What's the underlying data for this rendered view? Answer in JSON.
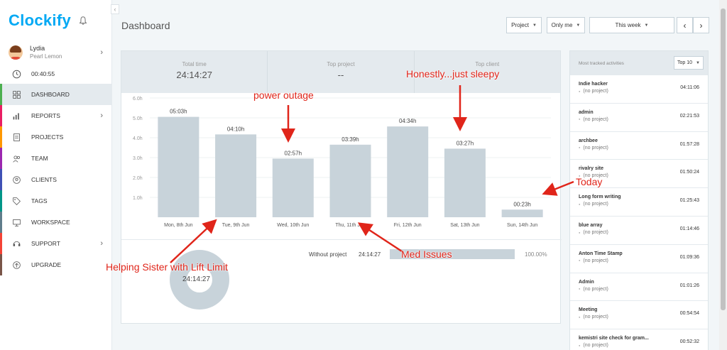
{
  "app": {
    "logo_text": "Clockify",
    "page_title": "Dashboard"
  },
  "user": {
    "name": "Lydia",
    "workspace": "Pearl Lemon"
  },
  "timer": "00:40:55",
  "nav": [
    {
      "label": "DASHBOARD",
      "icon": "dashboard-icon",
      "color": "#4caf50"
    },
    {
      "label": "REPORTS",
      "icon": "reports-icon",
      "color": "#e91e63"
    },
    {
      "label": "PROJECTS",
      "icon": "projects-icon",
      "color": "#ff9800"
    },
    {
      "label": "TEAM",
      "icon": "team-icon",
      "color": "#9c27b0"
    },
    {
      "label": "CLIENTS",
      "icon": "clients-icon",
      "color": "#3f51b5"
    },
    {
      "label": "TAGS",
      "icon": "tags-icon",
      "color": "#009688"
    },
    {
      "label": "WORKSPACE",
      "icon": "workspace-icon",
      "color": "#607d8b"
    },
    {
      "label": "SUPPORT",
      "icon": "support-icon",
      "color": "#f44336"
    },
    {
      "label": "UPGRADE",
      "icon": "upgrade-icon",
      "color": "#795548"
    }
  ],
  "toolbar": {
    "project_filter": "Project",
    "user_filter": "Only me",
    "period": "This week",
    "prev": "‹",
    "next": "›"
  },
  "stats": {
    "total_time_label": "Total time",
    "total_time_value": "24:14:27",
    "top_project_label": "Top project",
    "top_project_value": "--",
    "top_client_label": "Top client"
  },
  "chart_data": {
    "type": "bar",
    "categories": [
      "Mon, 8th Jun",
      "Tue, 9th Jun",
      "Wed, 10th Jun",
      "Thu, 11th Jun",
      "Fri, 12th Jun",
      "Sat, 13th Jun",
      "Sun, 14th Jun"
    ],
    "values": [
      5.05,
      4.1667,
      2.95,
      3.65,
      4.5667,
      3.45,
      0.3833
    ],
    "data_labels": [
      "05:03h",
      "04:10h",
      "02:57h",
      "03:39h",
      "04:34h",
      "03:27h",
      "00:23h"
    ],
    "yticks": [
      "1.0h",
      "2.0h",
      "3.0h",
      "4.0h",
      "5.0h",
      "6.0h"
    ],
    "ylim": [
      0,
      6
    ],
    "grid": true,
    "bar_color": "#c8d3da"
  },
  "breakdown": {
    "project": "Without project",
    "time": "24:14:27",
    "percent": "100.00%",
    "share": 1.0,
    "donut_total": "24:14:27",
    "donut_color": "#c8d3da"
  },
  "panel": {
    "title": "Most tracked activities",
    "top_select": "Top 10",
    "activities": [
      {
        "name": "Indie hacker",
        "project": "(no project)",
        "time": "04:11:06"
      },
      {
        "name": "admin",
        "project": "(no project)",
        "time": "02:21:53"
      },
      {
        "name": "archbee",
        "project": "(no project)",
        "time": "01:57:28"
      },
      {
        "name": "rivalry site",
        "project": "(no project)",
        "time": "01:50:24"
      },
      {
        "name": "Long form writing",
        "project": "(no project)",
        "time": "01:25:43"
      },
      {
        "name": "blue array",
        "project": "(no project)",
        "time": "01:14:46"
      },
      {
        "name": "Anton Time Stamp",
        "project": "(no project)",
        "time": "01:09:36"
      },
      {
        "name": "Admin",
        "project": "(no project)",
        "time": "01:01:26"
      },
      {
        "name": "Meeting",
        "project": "(no project)",
        "time": "00:54:54"
      },
      {
        "name": "kemistri site check for gram...",
        "project": "(no project)",
        "time": "00:52:32"
      }
    ]
  },
  "annotations": {
    "power": "power outage",
    "sleepy": "Honestly...just sleepy",
    "today": "Today",
    "med": "Med Issues",
    "sister": "Helping Sister with Lift Limit"
  },
  "colors": {
    "accent": "#03a9f4",
    "annotation": "#e0251a"
  }
}
